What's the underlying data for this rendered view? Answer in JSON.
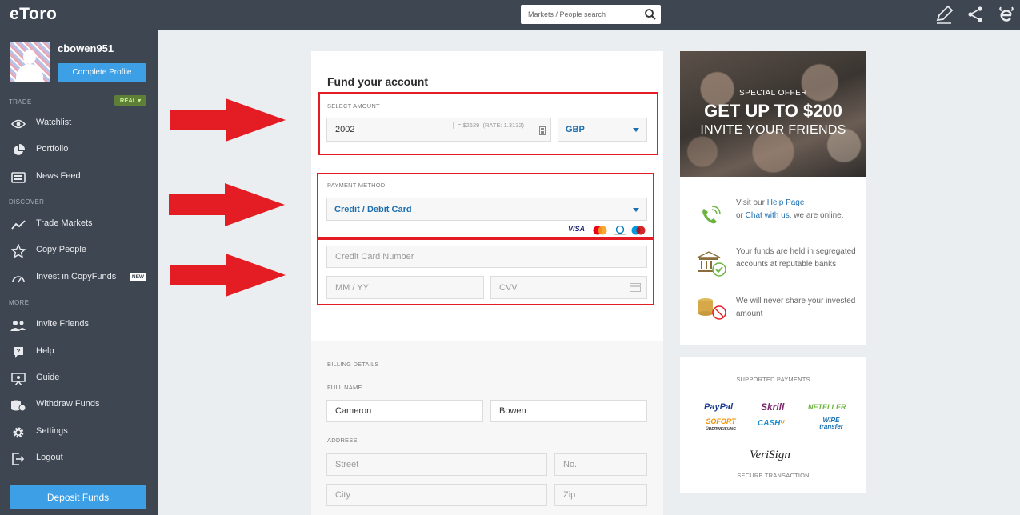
{
  "brand": {
    "logo": "eToro"
  },
  "user": {
    "username": "cbowen951",
    "complete_profile": "Complete Profile"
  },
  "sidebar": {
    "trade_label": "TRADE",
    "account_badge": "REAL",
    "discover_label": "DISCOVER",
    "more_label": "MORE",
    "new_badge": "NEW",
    "items": [
      {
        "label": "Watchlist",
        "icon": "eye-icon"
      },
      {
        "label": "Portfolio",
        "icon": "pie-chart-icon"
      },
      {
        "label": "News Feed",
        "icon": "newspaper-icon"
      },
      {
        "label": "Trade Markets",
        "icon": "trend-chart-icon"
      },
      {
        "label": "Copy People",
        "icon": "star-icon"
      },
      {
        "label": "Invest in CopyFunds",
        "icon": "gauge-icon"
      },
      {
        "label": "Invite Friends",
        "icon": "users-icon"
      },
      {
        "label": "Help",
        "icon": "help-icon"
      },
      {
        "label": "Guide",
        "icon": "presentation-icon"
      },
      {
        "label": "Withdraw Funds",
        "icon": "coins-icon"
      },
      {
        "label": "Settings",
        "icon": "gear-icon"
      },
      {
        "label": "Logout",
        "icon": "logout-icon"
      }
    ],
    "deposit_button": "Deposit Funds"
  },
  "topbar": {
    "search_placeholder": "Markets / People search"
  },
  "fund": {
    "title": "Fund your account",
    "select_amount_label": "SELECT AMOUNT",
    "amount_value": "2002",
    "amount_conversion": "= $2629",
    "amount_rate": "(RATE: 1.3132)",
    "currency": "GBP",
    "payment_method_label": "PAYMENT METHOD",
    "payment_method": "Credit / Debit Card",
    "card_brands": [
      "VISA",
      "Mastercard",
      "Diners Club",
      "Maestro"
    ],
    "card_number_placeholder": "Credit Card Number",
    "expiry_placeholder": "MM / YY",
    "cvv_placeholder": "CVV"
  },
  "billing": {
    "section_label": "BILLING DETAILS",
    "full_name_label": "FULL NAME",
    "first_name": "Cameron",
    "last_name": "Bowen",
    "address_label": "ADDRESS",
    "street_placeholder": "Street",
    "number_placeholder": "No.",
    "city_placeholder": "City",
    "zip_placeholder": "Zip"
  },
  "promo": {
    "line1": "SPECIAL OFFER",
    "line2": "GET UP TO $200",
    "line3": "INVITE YOUR FRIENDS"
  },
  "info": {
    "help_prefix": "Visit our ",
    "help_link": "Help Page",
    "help_mid": "or ",
    "chat_link": "Chat with us",
    "help_suffix": ", we are online.",
    "funds_text": "Your funds are held in segregated accounts at reputable banks",
    "share_text": "We will never share your invested amount"
  },
  "payments": {
    "title": "SUPPORTED PAYMENTS",
    "logos": [
      "PayPal",
      "Skrill",
      "NETELLER",
      "SOFORT",
      "CASH",
      "WIRE transfer"
    ],
    "sofort_sub": "ÜBERWEISUNG",
    "verisign": "VeriSign",
    "secure_label": "SECURE TRANSACTION"
  },
  "colors": {
    "sidebar_bg": "#3e4652",
    "accent_blue": "#3d9fe6",
    "highlight_red": "#e41d24",
    "link_blue": "#1f6fb0"
  }
}
